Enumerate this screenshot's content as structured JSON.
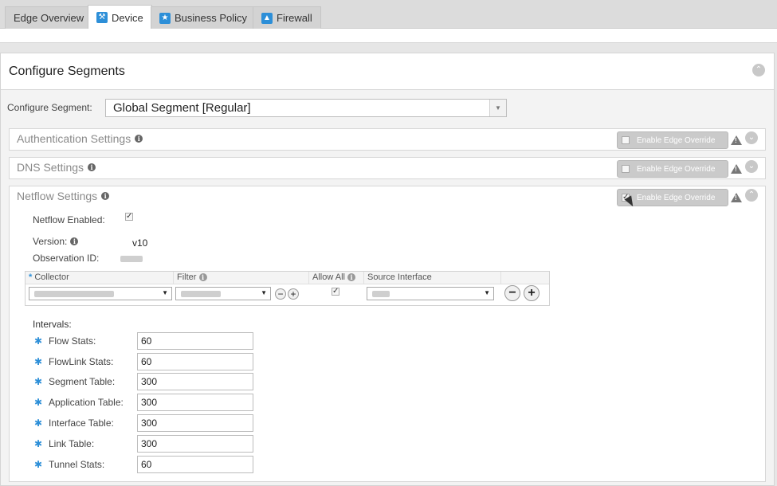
{
  "tabs": [
    {
      "label": "Edge Overview",
      "icon": "none",
      "active": false
    },
    {
      "label": "Device",
      "icon": "wrench-icon",
      "active": true
    },
    {
      "label": "Business Policy",
      "icon": "badge-icon",
      "active": false
    },
    {
      "label": "Firewall",
      "icon": "flame-icon",
      "active": false
    }
  ],
  "panel": {
    "title": "Configure Segments"
  },
  "segment": {
    "label": "Configure Segment:",
    "value": "Global Segment [Regular]"
  },
  "sections": {
    "auth": {
      "title": "Authentication Settings",
      "override_label": "Enable Edge Override",
      "override_checked": false
    },
    "dns": {
      "title": "DNS Settings",
      "override_label": "Enable Edge Override",
      "override_checked": false
    },
    "netflow": {
      "title": "Netflow Settings",
      "override_label": "Enable Edge Override",
      "override_checked": true
    }
  },
  "netflow": {
    "enabled_label": "Netflow Enabled:",
    "enabled": true,
    "version_label": "Version:",
    "version_value": "v10",
    "observation_label": "Observation ID:",
    "table": {
      "headers": {
        "collector": "Collector",
        "filter": "Filter",
        "allow_all": "Allow All",
        "source_interface": "Source Interface"
      },
      "allow_all_checked": true
    },
    "intervals_label": "Intervals:",
    "intervals": [
      {
        "label": "Flow Stats:",
        "value": "60"
      },
      {
        "label": "FlowLink Stats:",
        "value": "60"
      },
      {
        "label": "Segment Table:",
        "value": "300"
      },
      {
        "label": "Application Table:",
        "value": "300"
      },
      {
        "label": "Interface Table:",
        "value": "300"
      },
      {
        "label": "Link Table:",
        "value": "300"
      },
      {
        "label": "Tunnel Stats:",
        "value": "60"
      }
    ]
  },
  "colors": {
    "accent": "#2d8fd8",
    "override_bg": "#cacaca"
  }
}
